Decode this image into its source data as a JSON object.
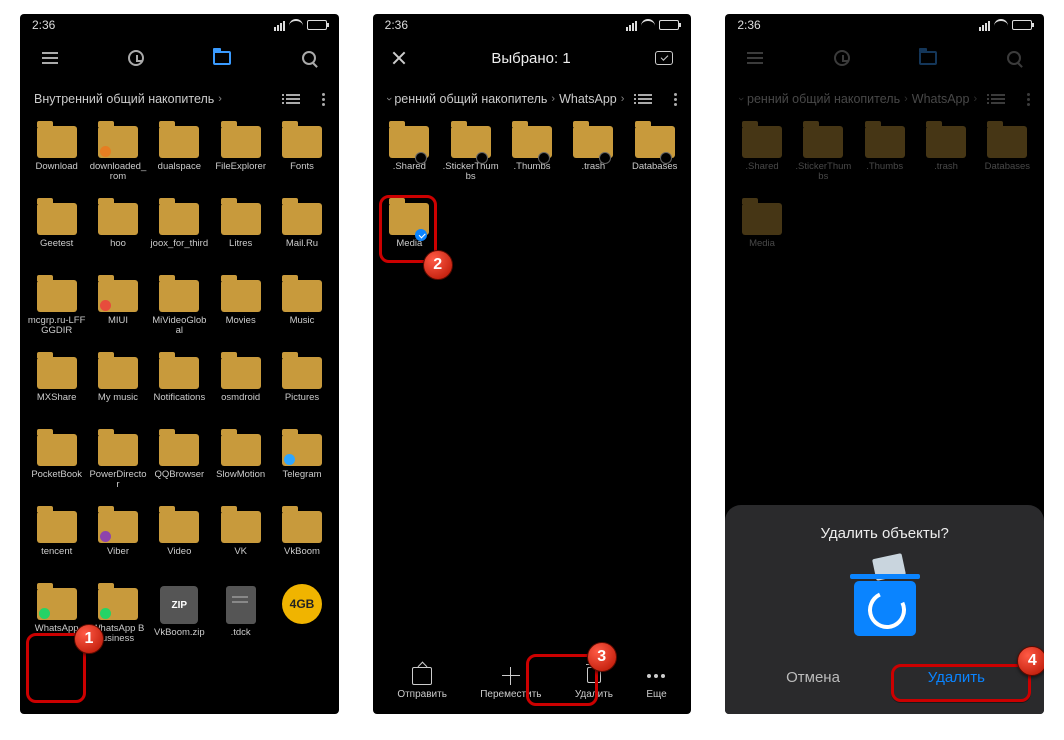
{
  "status_time": "2:36",
  "phone1": {
    "breadcrumb": "Внутренний общий накопитель",
    "folders": [
      "Download",
      "downloaded_rom",
      "dualspace",
      "FileExplorer",
      "Fonts",
      "Geetest",
      "hoo",
      "joox_for_third",
      "Litres",
      "Mail.Ru",
      "mcgrp.ru-LFFGGDIR",
      "MIUI",
      "MiVideoGlobal",
      "Movies",
      "Music",
      "MXShare",
      "My music",
      "Notifications",
      "osmdroid",
      "Pictures",
      "PocketBook",
      "PowerDirector",
      "QQBrowser",
      "SlowMotion",
      "Telegram",
      "tencent",
      "Viber",
      "Video",
      "VK",
      "VkBoom",
      "WhatsApp",
      "WhatsApp Business"
    ],
    "files": {
      "zip_label": "ZIP",
      "zip_name": "VkBoom.zip",
      "doc_name": ".tdck",
      "disk_label": "4GB"
    }
  },
  "phone2": {
    "selection_title": "Выбрано: 1",
    "breadcrumb_root": "ренний общий накопитель",
    "breadcrumb_folder": "WhatsApp",
    "folders": [
      ".Shared",
      ".StickerThumbs",
      ".Thumbs",
      ".trash",
      "Databases",
      "Media"
    ],
    "actions": {
      "send": "Отправить",
      "move": "Переместить",
      "delete": "Удалить",
      "more": "Еще"
    }
  },
  "phone3": {
    "breadcrumb_root": "ренний общий накопитель",
    "breadcrumb_folder": "WhatsApp",
    "folders": [
      ".Shared",
      ".StickerThumbs",
      ".Thumbs",
      ".trash",
      "Databases",
      "Media"
    ],
    "dialog": {
      "title": "Удалить объекты?",
      "cancel": "Отмена",
      "confirm": "Удалить"
    }
  },
  "steps": {
    "1": "1",
    "2": "2",
    "3": "3",
    "4": "4"
  }
}
